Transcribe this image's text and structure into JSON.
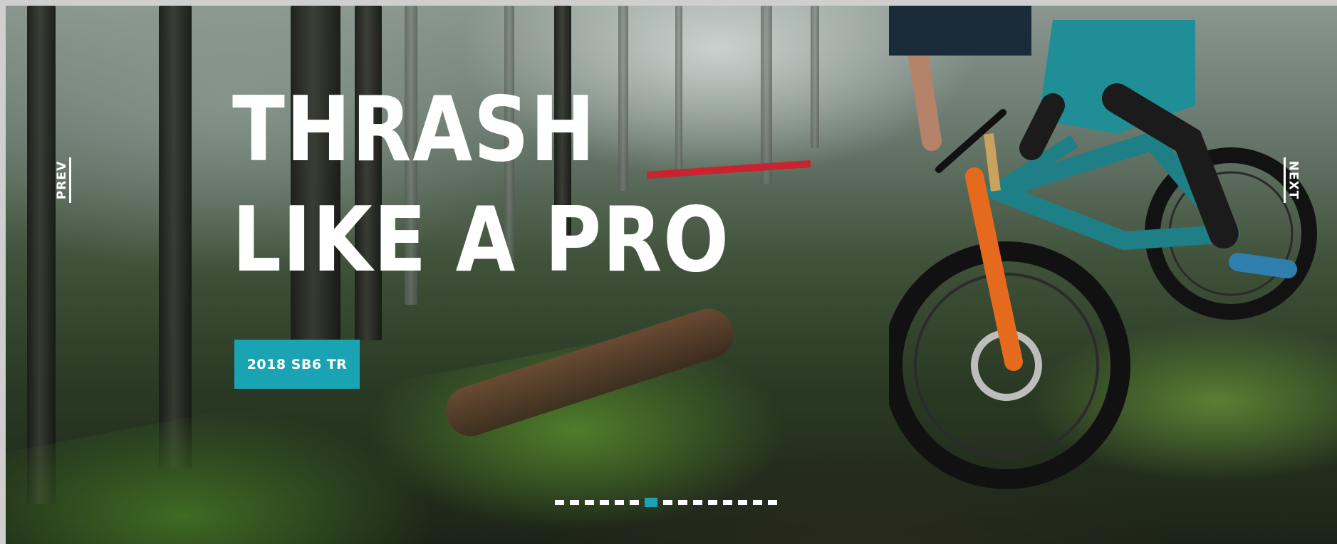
{
  "hero": {
    "headline_line1": "THRASH",
    "headline_line2": "LIKE A PRO",
    "cta_label": "2018 SB6 TR",
    "prev_label": "PREV",
    "next_label": "NEXT",
    "accent_color": "#1aa3b2",
    "slide_count": 15,
    "active_slide": 6,
    "image_subject": "mountain biker descending mossy forest trail"
  }
}
